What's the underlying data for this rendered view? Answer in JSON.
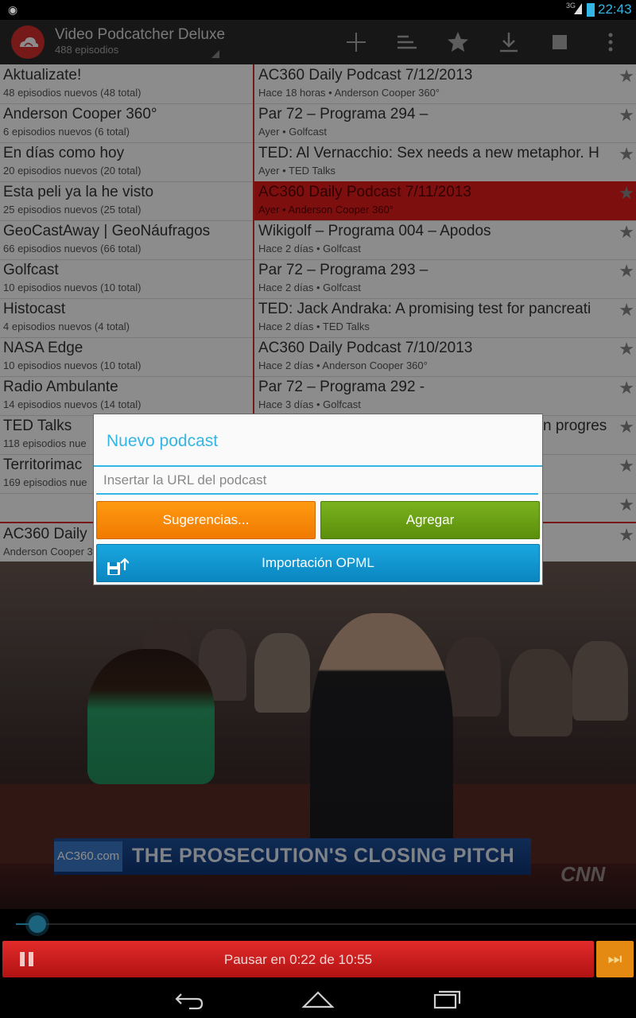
{
  "status_bar": {
    "network": "3G",
    "time": "22:43"
  },
  "action_bar": {
    "title": "Video Podcatcher Deluxe",
    "subtitle": "488 episodios",
    "icons": [
      "add-icon",
      "sort-icon",
      "star-icon",
      "download-icon",
      "stop-icon",
      "overflow-menu-icon"
    ]
  },
  "podcasts": [
    {
      "title": "Aktualizate!",
      "sub": "48 episodios nuevos (48 total)"
    },
    {
      "title": "Anderson Cooper 360°",
      "sub": "6 episodios nuevos (6 total)"
    },
    {
      "title": "En días como hoy",
      "sub": "20 episodios nuevos (20 total)"
    },
    {
      "title": "Esta peli ya la he visto",
      "sub": "25 episodios nuevos (25 total)"
    },
    {
      "title": "GeoCastAway | GeoNáufragos",
      "sub": "66 episodios nuevos (66 total)"
    },
    {
      "title": "Golfcast",
      "sub": "10 episodios nuevos (10 total)"
    },
    {
      "title": "Histocast",
      "sub": "4 episodios nuevos (4 total)"
    },
    {
      "title": "NASA Edge",
      "sub": "10 episodios nuevos (10 total)"
    },
    {
      "title": "Radio Ambulante",
      "sub": "14 episodios nuevos (14 total)"
    },
    {
      "title": "TED Talks",
      "sub": "118 episodios nue"
    },
    {
      "title": "Territorimac",
      "sub": "169 episodios nue"
    }
  ],
  "episodes": [
    {
      "title": "AC360 Daily Podcast 7/12/2013",
      "sub": "Hace 18 horas • Anderson Cooper 360°"
    },
    {
      "title": "Par 72 – Programa 294 –",
      "sub": "Ayer • Golfcast"
    },
    {
      "title": "TED: Al Vernacchio: Sex needs a new metaphor. H",
      "sub": "Ayer • TED Talks"
    },
    {
      "title": "AC360 Daily Podcast 7/11/2013",
      "sub": "Ayer • Anderson Cooper 360°"
    },
    {
      "title": "Wikigolf – Programa 004 – Apodos",
      "sub": "Hace 2 días • Golfcast"
    },
    {
      "title": "Par 72 – Programa 293 –",
      "sub": "Hace 2 días • Golfcast"
    },
    {
      "title": "TED: Jack Andraka: A promising test for pancreati",
      "sub": "Hace 2 días • TED Talks"
    },
    {
      "title": "AC360 Daily Podcast 7/10/2013",
      "sub": "Hace 2 días • Anderson Cooper 360°"
    },
    {
      "title": "Par 72 – Programa 292 -",
      "sub": "Hace 3 días • Golfcast"
    },
    {
      "title": "n progres",
      "sub": ""
    },
    {
      "title": "",
      "sub": ""
    },
    {
      "title": "",
      "sub": ""
    }
  ],
  "now_playing": {
    "title": "AC360 Daily",
    "sub": "Anderson Cooper 3"
  },
  "video": {
    "channel_logo": "AC360.com",
    "headline": "THE PROSECUTION'S CLOSING PITCH",
    "network": "CNN"
  },
  "player": {
    "progress": 0.034,
    "pause_label": "Pausar en 0:22 de 10:55"
  },
  "dialog": {
    "title": "Nuevo podcast",
    "url_placeholder": "Insertar la URL del podcast",
    "url_value": "",
    "suggestions_label": "Sugerencias...",
    "add_label": "Agregar",
    "opml_label": "Importación OPML"
  },
  "colors": {
    "accent": "#33b5e5",
    "selected_row": "#e51d1d",
    "orange": "#f07a00",
    "green": "#5b8e0b",
    "blue": "#0a86c0"
  }
}
